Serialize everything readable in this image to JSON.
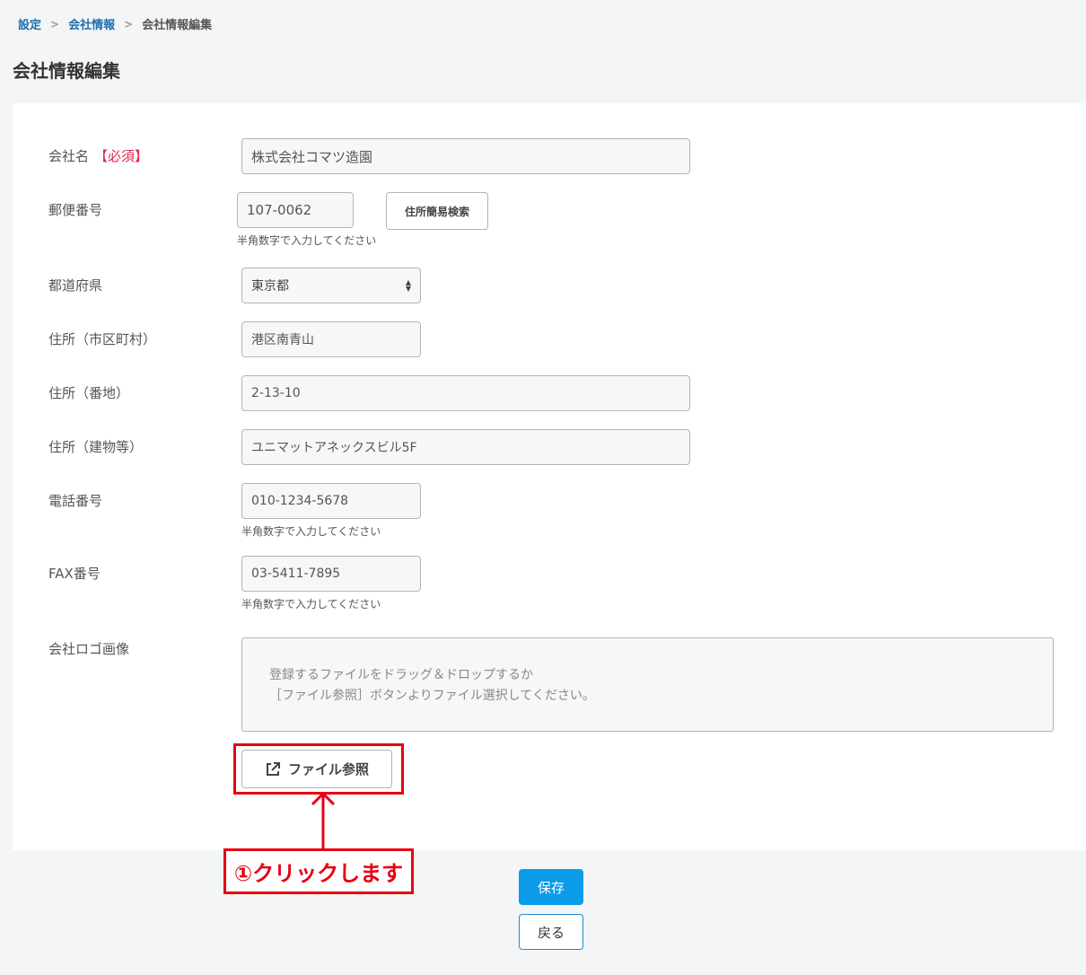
{
  "breadcrumb": {
    "item1": "設定",
    "item2": "会社情報",
    "current": "会社情報編集",
    "sep": ">"
  },
  "page_title": "会社情報編集",
  "form": {
    "company_name": {
      "label": "会社名",
      "required": "【必須】",
      "value": "株式会社コマツ造園"
    },
    "postal_code": {
      "label": "郵便番号",
      "value": "107-0062",
      "hint": "半角数字で入力してください",
      "search_button": "住所簡易検索"
    },
    "prefecture": {
      "label": "都道府県",
      "value": "東京都"
    },
    "city": {
      "label": "住所（市区町村）",
      "value": "港区南青山"
    },
    "street": {
      "label": "住所（番地）",
      "value": "2-13-10"
    },
    "building": {
      "label": "住所（建物等）",
      "value": "ユニマットアネックスビル5F"
    },
    "phone": {
      "label": "電話番号",
      "value": "010-1234-5678",
      "hint": "半角数字で入力してください"
    },
    "fax": {
      "label": "FAX番号",
      "value": "03-5411-7895",
      "hint": "半角数字で入力してください"
    },
    "logo": {
      "label": "会社ロゴ画像",
      "drop_line1": "登録するファイルをドラッグ＆ドロップするか",
      "drop_line2": "［ファイル参照］ボタンよりファイル選択してください。",
      "browse_button": "ファイル参照"
    }
  },
  "annotation": {
    "callout": "①クリックします",
    "color": "#e60012"
  },
  "actions": {
    "save": "保存",
    "back": "戻る"
  },
  "colors": {
    "primary": "#0b9be8",
    "link": "#1a6fb0",
    "required": "#e0284f"
  }
}
